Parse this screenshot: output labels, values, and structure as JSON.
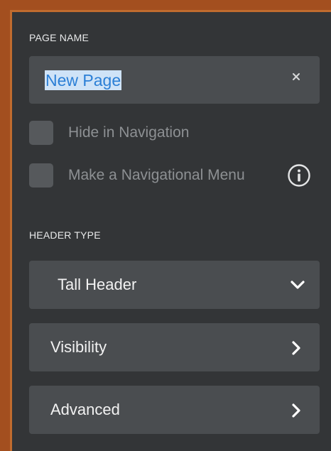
{
  "page_name": {
    "label": "PAGE NAME",
    "value": "New Page",
    "clear_icon": "close-icon"
  },
  "options": [
    {
      "label": "Hide in Navigation",
      "checked": false
    },
    {
      "label": "Make a Navigational Menu",
      "checked": false,
      "icon": "info-icon"
    }
  ],
  "header_type": {
    "label": "HEADER TYPE",
    "selected": "Tall Header",
    "icon": "chevron-down-icon"
  },
  "sections": [
    {
      "label": "Visibility",
      "icon": "chevron-right-icon"
    },
    {
      "label": "Advanced",
      "icon": "chevron-right-icon"
    }
  ],
  "colors": {
    "panel_bg": "#333537",
    "field_bg": "#4a4d50",
    "frame": "#a34f1f",
    "selection_text": "#2b7fd6",
    "selection_bg": "#cfe3f7"
  }
}
